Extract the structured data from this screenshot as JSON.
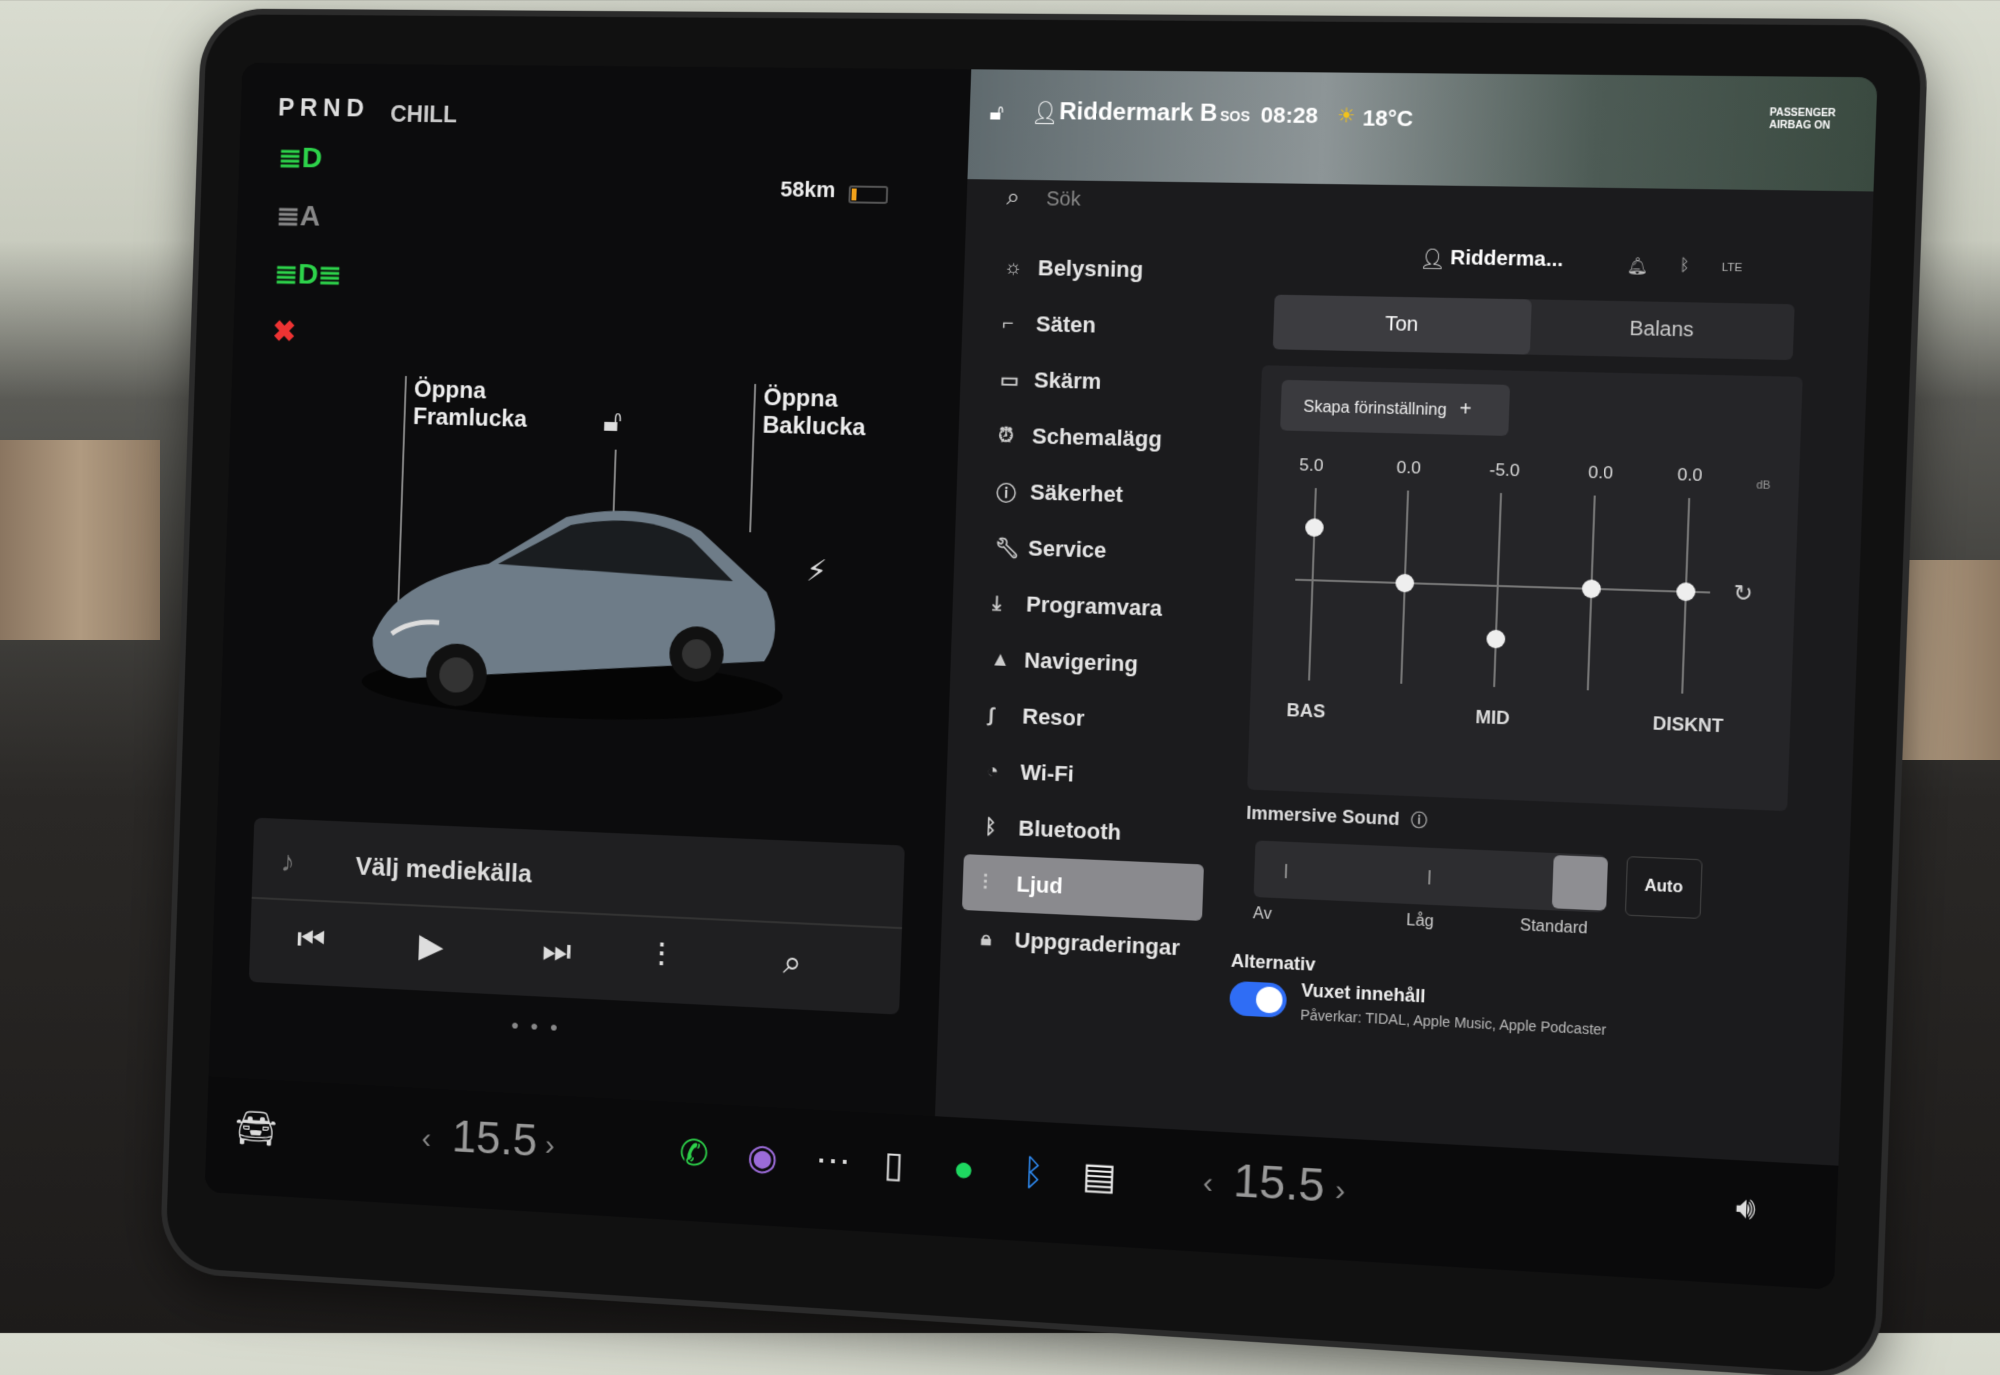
{
  "status": {
    "gears": "PRND",
    "drive_mode": "CHILL",
    "range": "58km"
  },
  "car": {
    "frunk_line1": "Öppna",
    "frunk_line2": "Framlucka",
    "trunk_line1": "Öppna",
    "trunk_line2": "Baklucka"
  },
  "media": {
    "source_label": "Välj mediekälla"
  },
  "header": {
    "profile": "Riddermark B",
    "sos": "SOS",
    "time": "08:28",
    "temperature": "18°C",
    "airbag_line1": "PASSENGER",
    "airbag_line2": "AIRBAG ON",
    "user_short": "Ridderma...",
    "lte": "LTE"
  },
  "search": {
    "placeholder": "Sök"
  },
  "menu": {
    "items": [
      {
        "label": "Belysning",
        "icon": "light-icon"
      },
      {
        "label": "Säten",
        "icon": "seat-icon"
      },
      {
        "label": "Skärm",
        "icon": "display-icon"
      },
      {
        "label": "Schemalägg",
        "icon": "schedule-icon"
      },
      {
        "label": "Säkerhet",
        "icon": "safety-icon"
      },
      {
        "label": "Service",
        "icon": "wrench-icon"
      },
      {
        "label": "Programvara",
        "icon": "download-icon"
      },
      {
        "label": "Navigering",
        "icon": "navigation-icon"
      },
      {
        "label": "Resor",
        "icon": "trips-icon"
      },
      {
        "label": "Wi-Fi",
        "icon": "wifi-icon"
      },
      {
        "label": "Bluetooth",
        "icon": "bluetooth-icon"
      },
      {
        "label": "Ljud",
        "icon": "equalizer-icon"
      },
      {
        "label": "Uppgraderingar",
        "icon": "lock-icon"
      }
    ]
  },
  "audio": {
    "tabs": [
      "Ton",
      "Balans"
    ],
    "preset_label": "Skapa förinställning",
    "eq_values": [
      "5.0",
      "0.0",
      "-5.0",
      "0.0",
      "0.0"
    ],
    "db_unit": "dB",
    "eq_labels": [
      "BAS",
      "MID",
      "DISKNT"
    ],
    "immersive_title": "Immersive Sound",
    "immersive_levels": [
      "Av",
      "Låg",
      "Standard"
    ],
    "immersive_auto": "Auto",
    "alternativ_title": "Alternativ",
    "explicit_label": "Vuxet innehåll",
    "explicit_sub": "Påverkar: TIDAL, Apple Music, Apple Podcaster"
  },
  "dock": {
    "temp_left": "15.5",
    "temp_right": "15.5"
  }
}
